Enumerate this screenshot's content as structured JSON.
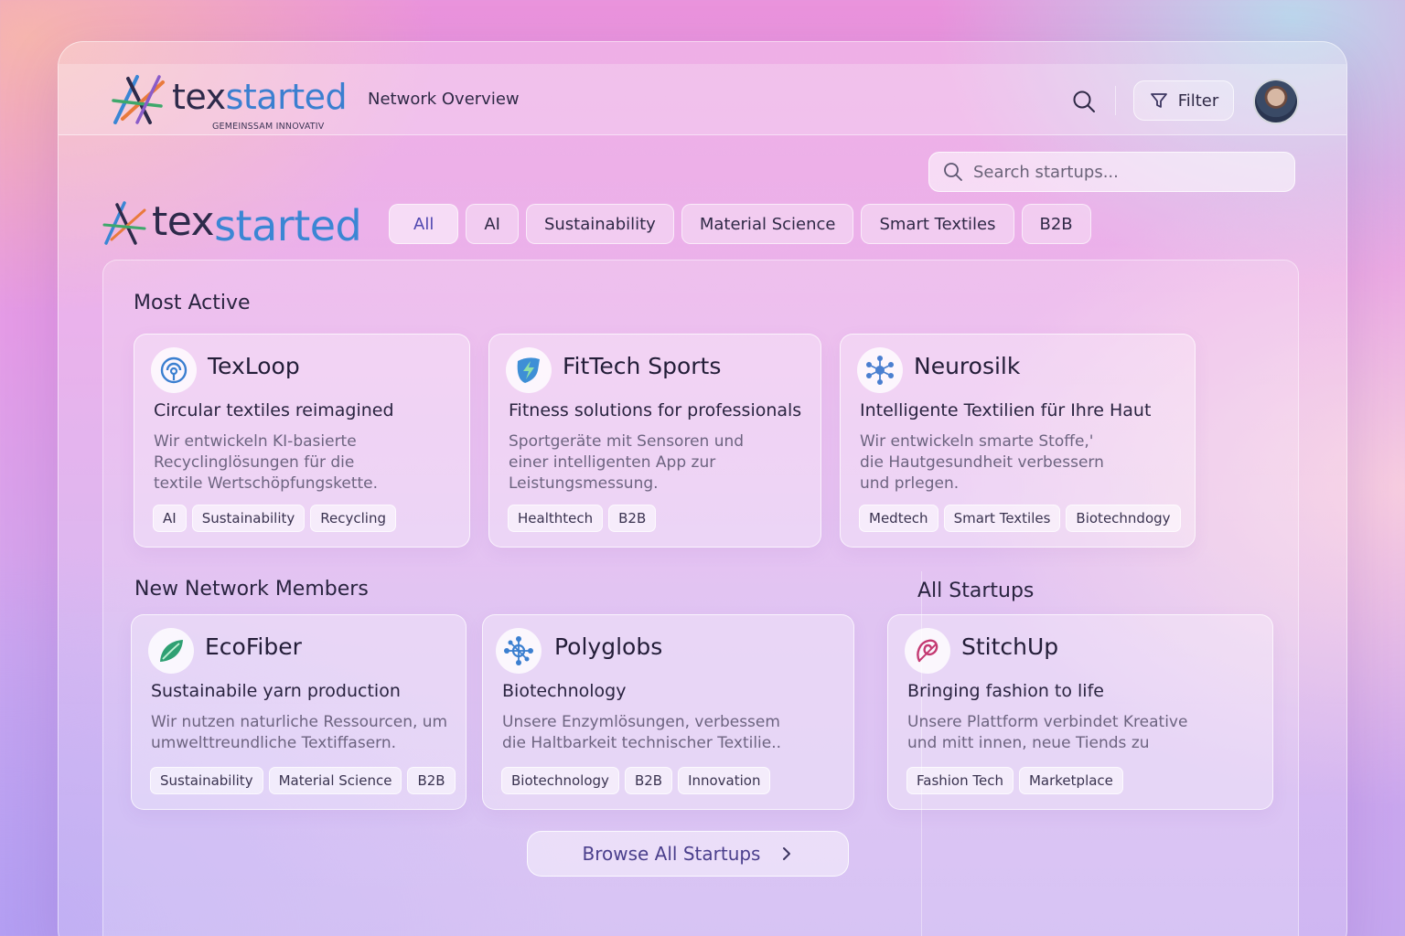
{
  "brand": {
    "word_part1": "tex",
    "word_part2": "started",
    "tagline": "GEMEINSSAM INNOVATIV"
  },
  "header": {
    "nav_title": "Network Overview",
    "filter_label": "Filter"
  },
  "search": {
    "placeholder": "Search startups..."
  },
  "filters": [
    "All",
    "AI",
    "Sustainability",
    "Material Science",
    "Smart Textiles",
    "B2B"
  ],
  "sections": {
    "most_active": "Most Active",
    "new_members": "New Network Members",
    "all_startups": "All Startups"
  },
  "cards": {
    "texloop": {
      "name": "TexLoop",
      "tagline": "Circular textiles reimagined",
      "desc1": "Wir entwickeln KI-basierte",
      "desc2": "Recyclinglösungen für die",
      "desc3": "textile Wertschöpfungskette.",
      "tags": [
        "AI",
        "Sustainability",
        "Recycling"
      ]
    },
    "fittech": {
      "name": "FitTech Sports",
      "tagline": "Fitness solutions for professionals",
      "desc1": "Sportgeräte mit Sensoren und",
      "desc2": "einer intelligenten App zur",
      "desc3": "Leistungsmessung.",
      "tags": [
        "Healthtech",
        "B2B"
      ]
    },
    "neurosilk": {
      "name": "Neurosilk",
      "tagline": "Intelligente Textilien für Ihre Haut",
      "desc1": "Wir entwickeln smarte Stoffe,'",
      "desc2": "die Hautgesundheit verbessern",
      "desc3": "und prlegen.",
      "tags": [
        "Medtech",
        "Smart Textiles",
        "Biotechndogy"
      ]
    },
    "ecofiber": {
      "name": "EcoFiber",
      "tagline": "Sustainabile yarn production",
      "desc1": "Wir nutzen naturliche Ressourcen, um",
      "desc2": "umwelttreundliche Textiffasern.",
      "tags": [
        "Sustainability",
        "Material Science",
        "B2B"
      ]
    },
    "polyglobs": {
      "name": "Polyglobs",
      "tagline": "Biotechnology",
      "desc1": "Unsere Enzymlösungen, verbessem",
      "desc2": "die Haltbarkeit technischer Textilie..",
      "tags": [
        "Biotechnology",
        "B2B",
        "Innovation"
      ]
    },
    "stitchup": {
      "name": "StitchUp",
      "tagline": "Bringing fashion to life",
      "desc1": "Unsere Plattform verbindet Kreative",
      "desc2": "und mitt innen, neue Tiends zu",
      "tags": [
        "Fashion Tech",
        "Marketplace"
      ]
    }
  },
  "browse_label": "Browse All Startups",
  "colors": {
    "accent": "#4f47b0",
    "brand_blue": "#3b86d4",
    "text_dark": "#2a2440",
    "text_muted": "#6d6480"
  },
  "icons": {
    "texloop": "recycle-loop-icon",
    "fittech": "lightning-icon",
    "neurosilk": "network-molecule-icon",
    "ecofiber": "leaf-icon",
    "polyglobs": "molecule-icon",
    "stitchup": "swirl-icon"
  }
}
